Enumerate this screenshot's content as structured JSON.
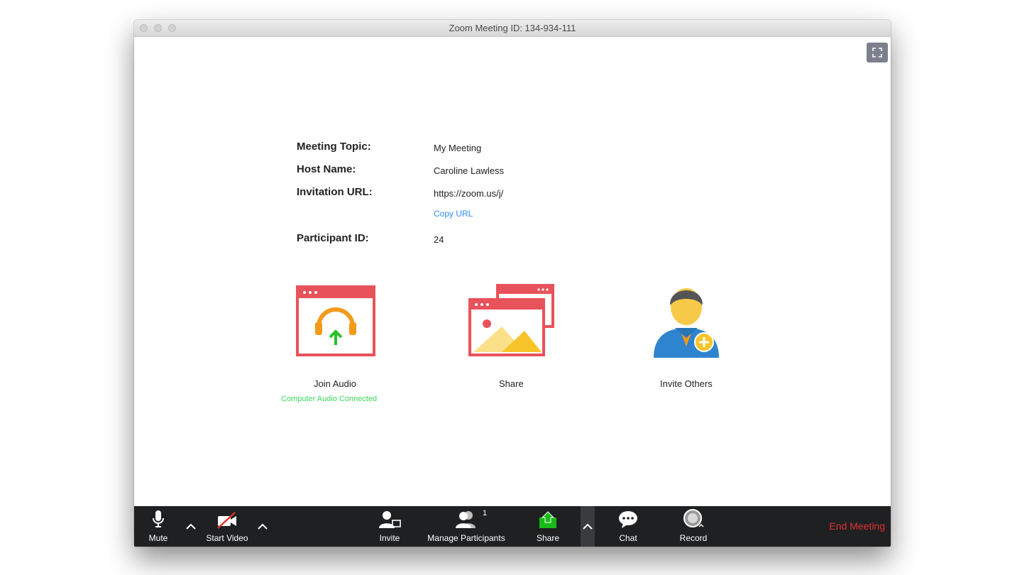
{
  "window": {
    "title": "Zoom Meeting ID: 134-934-111"
  },
  "meeting_info": [
    {
      "label": "Meeting Topic:",
      "value": "My Meeting"
    },
    {
      "label": "Host Name:",
      "value": "Caroline Lawless"
    },
    {
      "label": "Invitation URL:",
      "value": "https://zoom.us/j/",
      "action": "Copy URL"
    },
    {
      "label": "Participant ID:",
      "value": "24"
    }
  ],
  "tiles": {
    "join_audio": {
      "label": "Join Audio",
      "status": "Computer Audio Connected"
    },
    "share": {
      "label": "Share"
    },
    "invite_others": {
      "label": "Invite Others"
    }
  },
  "toolbar": {
    "mute": "Mute",
    "start_video": "Start Video",
    "invite": "Invite",
    "manage_participants": "Manage Participants",
    "participant_count": "1",
    "share": "Share",
    "chat": "Chat",
    "record": "Record",
    "end_meeting": "End Meeting"
  },
  "colors": {
    "accent_blue": "#2d8cff",
    "audio_connected_green": "#3bd95a",
    "end_meeting_red": "#e5302f",
    "toolbar_bg": "#1f2022",
    "share_green": "#1ab91a"
  }
}
